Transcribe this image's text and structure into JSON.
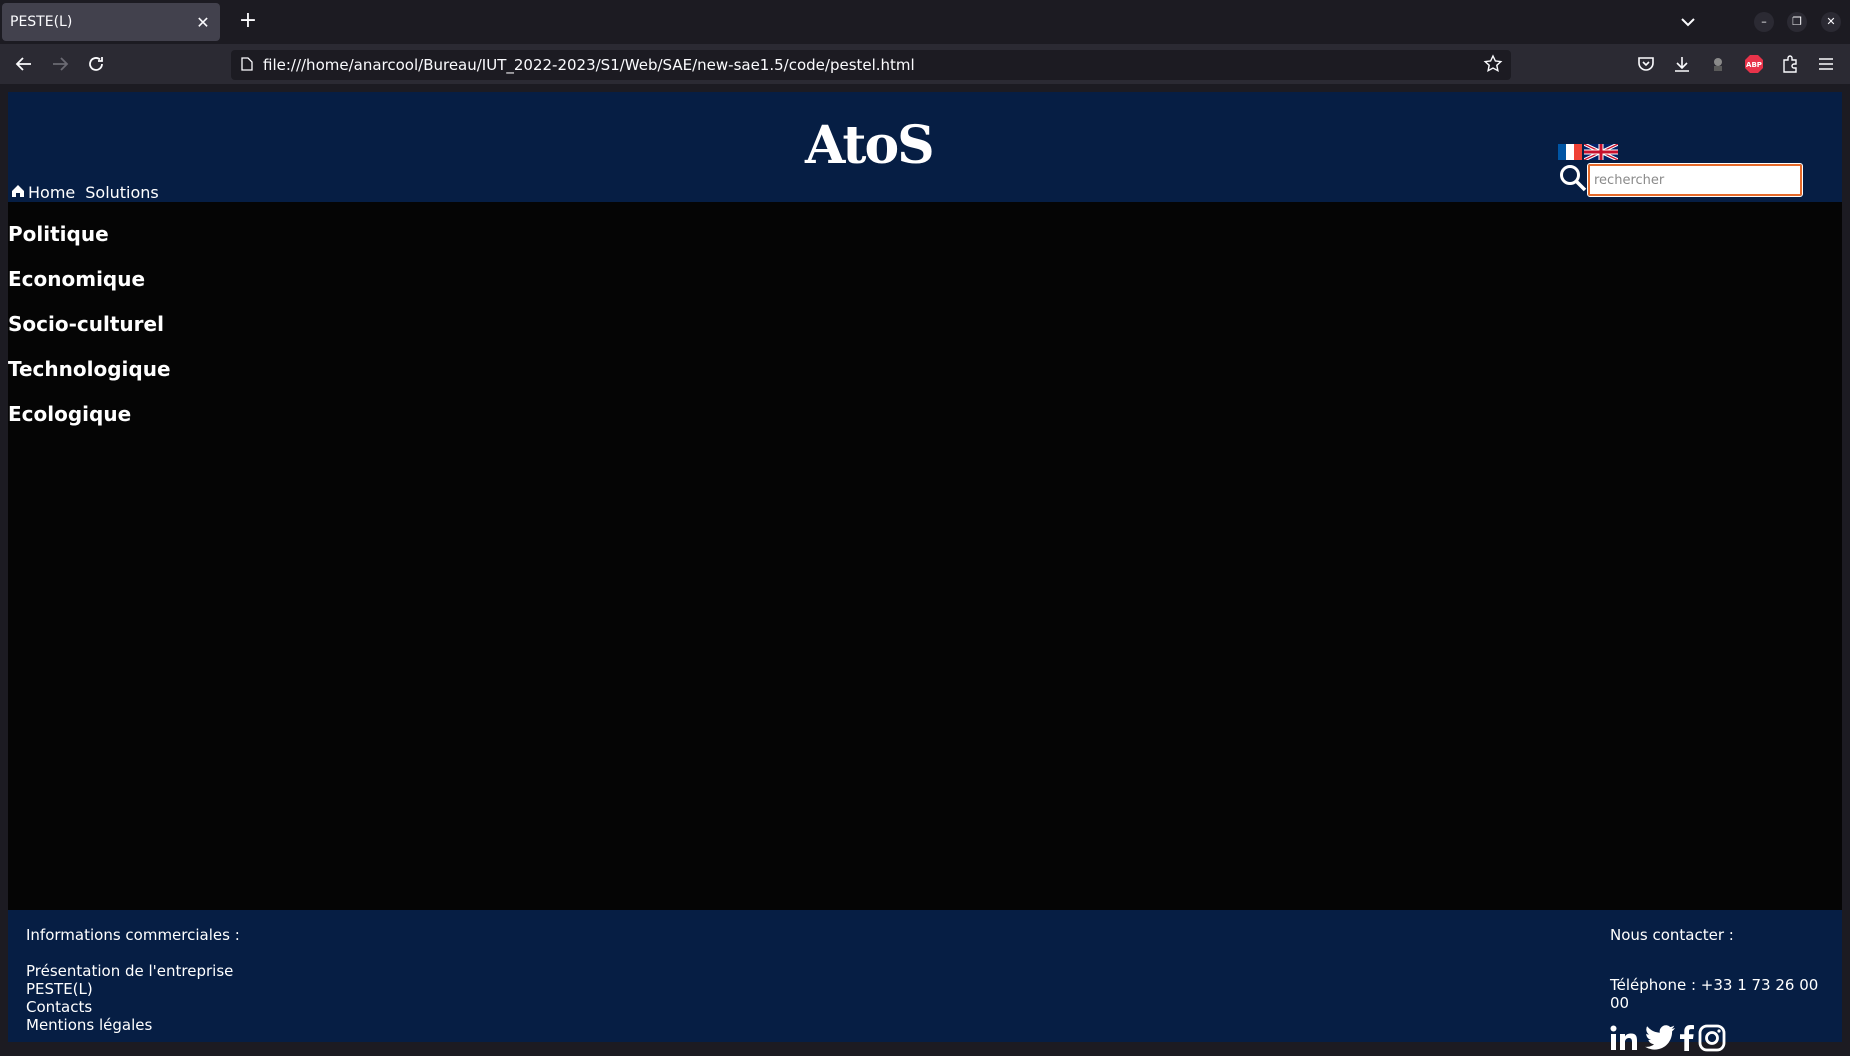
{
  "browser": {
    "tab_title": "PESTE(L)",
    "url": "file:///home/anarcool/Bureau/IUT_2022-2023/S1/Web/SAE/new-sae1.5/code/pestel.html",
    "extension_badge": "ABP"
  },
  "header": {
    "logo_text": "AtoS",
    "nav": [
      {
        "label": "Home",
        "icon": "home-icon"
      },
      {
        "label": "Solutions"
      }
    ],
    "search_placeholder": "rechercher",
    "languages": [
      "fr-flag-icon",
      "uk-flag-icon"
    ]
  },
  "sections": [
    "Politique",
    "Economique",
    "Socio-culturel",
    "Technologique",
    "Ecologique"
  ],
  "footer": {
    "left_heading": "Informations commerciales :",
    "links": [
      "Présentation de l'entreprise",
      "PESTE(L)",
      "Contacts",
      "Mentions légales"
    ],
    "right_heading": "Nous contacter :",
    "phone": "Téléphone : +33 1 73 26 00 00",
    "social": [
      "linkedin-icon",
      "twitter-icon",
      "facebook-icon",
      "instagram-icon"
    ]
  },
  "colors": {
    "header_bg": "#061e44",
    "page_bg": "#050505",
    "search_border": "#e56a2a"
  }
}
